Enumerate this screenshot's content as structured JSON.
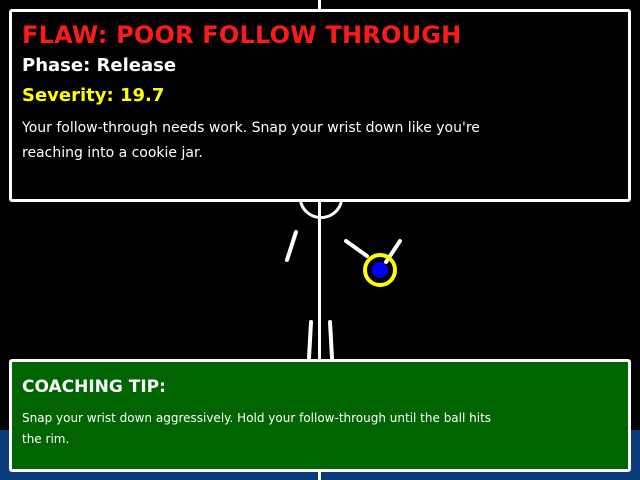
{
  "flaw": {
    "title": "FLAW: POOR FOLLOW THROUGH",
    "phase": "Phase: Release",
    "severity": "Severity: 19.7",
    "description": "Your follow-through needs work. Snap your wrist down like you're reaching into a cookie jar."
  },
  "coaching": {
    "heading": "COACHING TIP:",
    "text": "Snap your wrist down aggressively. Hold your follow-through until the ball hits the rim."
  },
  "colors": {
    "flaw_title": "#ff1a1a",
    "severity": "#ffff00",
    "tip_background": "#006400",
    "floor": "#0b3c7a",
    "ball": "#0000ff",
    "ball_ring": "#ffff00"
  },
  "figure": {
    "pose_phase": "release",
    "highlight": "wrist"
  }
}
